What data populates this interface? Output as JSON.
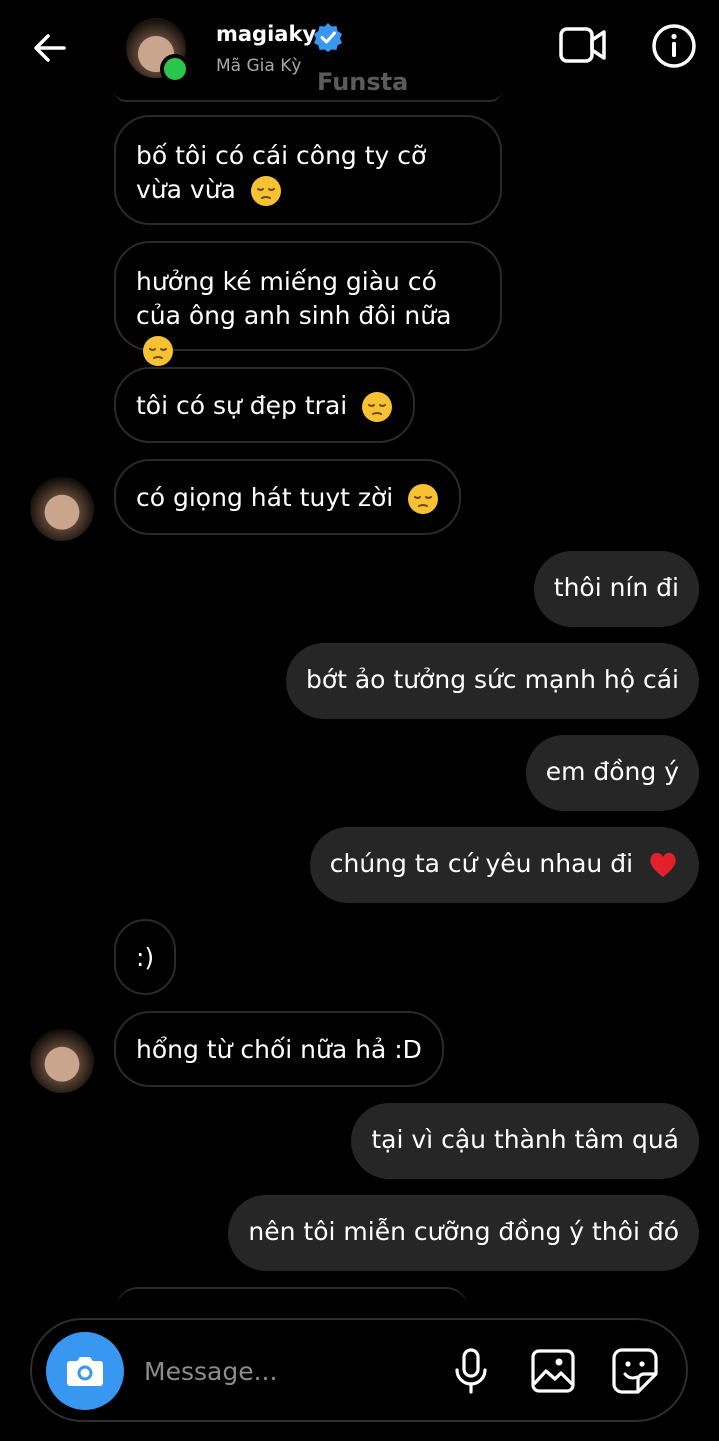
{
  "header": {
    "username": "magiaky",
    "display_name": "Mã Gia Kỳ",
    "watermark": "Funsta"
  },
  "messages": [
    {
      "side": "in",
      "text": "bố tôi có cái công ty cỡ vừa vừa",
      "emoji": "pensive-face"
    },
    {
      "side": "in",
      "text": "hưởng ké miếng giàu có của ông anh sinh đôi nữa",
      "emoji": "pensive-face"
    },
    {
      "side": "in",
      "text": "tôi có sự đẹp trai",
      "emoji": "pensive-face"
    },
    {
      "side": "in",
      "text": "có giọng hát tuyt zời",
      "emoji": "pensive-face"
    },
    {
      "side": "out",
      "text": "thôi nín đi"
    },
    {
      "side": "out",
      "text": "bớt ảo tưởng sức mạnh hộ cái"
    },
    {
      "side": "out",
      "text": "em đồng ý"
    },
    {
      "side": "out",
      "text": "chúng ta cứ yêu nhau đi",
      "emoji": "red-heart"
    },
    {
      "side": "in",
      "text": ":)"
    },
    {
      "side": "in",
      "text": "hổng từ chối nữa hả :D"
    },
    {
      "side": "out",
      "text": "tại vì cậu thành tâm quá"
    },
    {
      "side": "out",
      "text": "nên tôi miễn cưỡng đồng ý thôi đó"
    }
  ],
  "composer": {
    "placeholder": "Message..."
  },
  "colors": {
    "online": "#2bc44e",
    "accent": "#3897f0",
    "outgoing_bubble": "#262626",
    "background": "#000000"
  }
}
